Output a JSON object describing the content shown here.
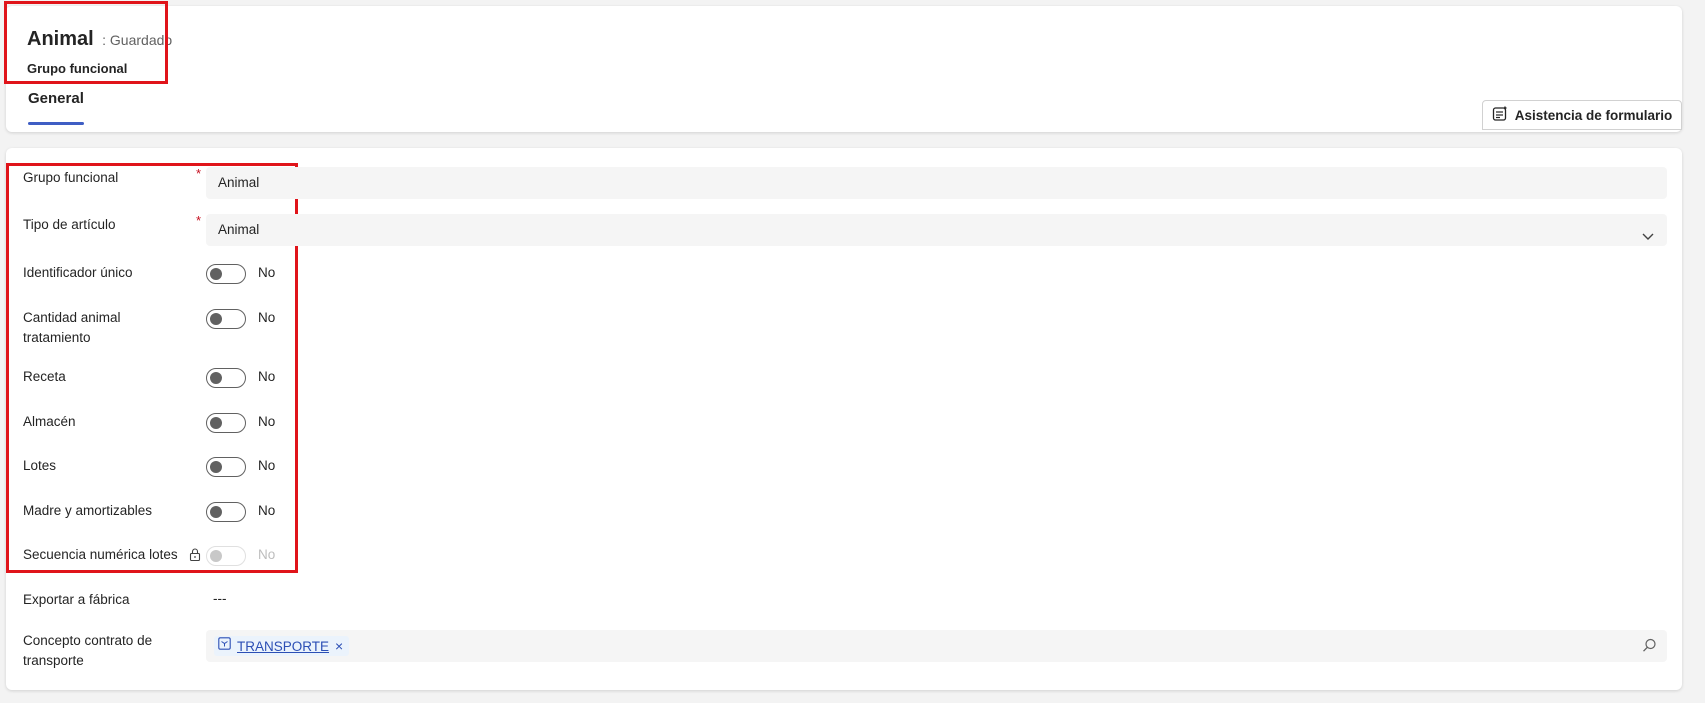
{
  "header": {
    "record_title": "Animal",
    "save_status": ": Guardado",
    "entity_name": "Grupo funcional"
  },
  "tabs": [
    {
      "label": "General",
      "selected": true
    }
  ],
  "toolbar": {
    "form_assist_label": "Asistencia de formulario"
  },
  "form": {
    "grupo_funcional": {
      "label": "Grupo funcional",
      "value": "Animal",
      "required_mark": "*"
    },
    "tipo_articulo": {
      "label": "Tipo de artículo",
      "value": "Animal",
      "required_mark": "*"
    },
    "toggles": [
      {
        "label": "Identificador único",
        "value": "No"
      },
      {
        "label": "Cantidad animal tratamiento",
        "value": "No"
      },
      {
        "label": "Receta",
        "value": "No"
      },
      {
        "label": "Almacén",
        "value": "No"
      },
      {
        "label": "Lotes",
        "value": "No"
      },
      {
        "label": "Madre y amortizables",
        "value": "No"
      },
      {
        "label": "Secuencia numérica lotes",
        "value": "No",
        "locked": true
      }
    ],
    "exportar_fabrica": {
      "label": "Exportar a fábrica",
      "value": "---"
    },
    "concepto_contrato": {
      "label": "Concepto contrato de transporte",
      "value": "TRANSPORTE",
      "remove": "×"
    }
  },
  "colors": {
    "accent": "#3f5ec4",
    "highlight": "#e0141a",
    "required": "#c50f1f",
    "link": "#2c4fb5"
  }
}
